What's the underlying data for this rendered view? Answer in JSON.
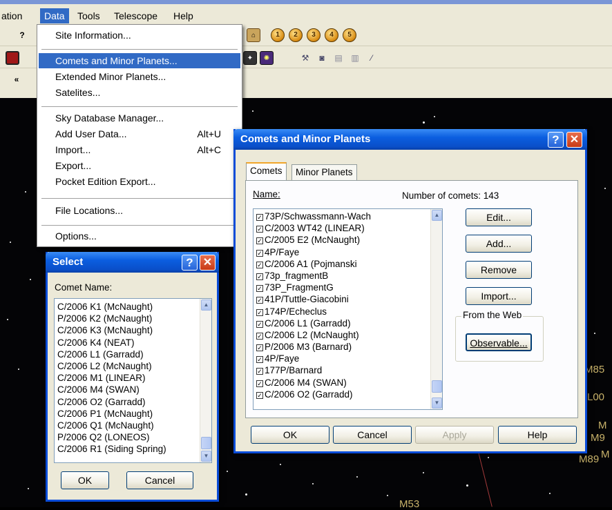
{
  "menubar": {
    "items": [
      "ation",
      "Data",
      "Tools",
      "Telescope",
      "Help"
    ]
  },
  "toolbar": {
    "icons": [
      "help-cursor-icon",
      "horizon-icon",
      "planet-1-icon",
      "planet-2-icon",
      "planet-3-icon",
      "planet-4-icon",
      "planet-5-icon",
      "rewind-icon"
    ]
  },
  "data_menu": {
    "site_information": "Site Information...",
    "comets": "Comets and Minor Planets...",
    "extended": "Extended Minor Planets...",
    "satellites": "Satelites...",
    "sky_db": "Sky Database Manager...",
    "add_user_data": "Add User Data...",
    "add_user_data_shortcut": "Alt+U",
    "import": "Import...",
    "import_shortcut": "Alt+C",
    "export": "Export...",
    "pocket": "Pocket Edition Export...",
    "file_locations": "File Locations...",
    "options": "Options..."
  },
  "comets_dialog": {
    "title": "Comets and Minor Planets",
    "help_glyph": "?",
    "close_glyph": "✕",
    "tabs": [
      "Comets",
      "Minor Planets"
    ],
    "name_label": "Name:",
    "count_label": "Number of comets: 143",
    "items": [
      "73P/Schwassmann-Wach",
      "C/2003 WT42 (LINEAR)",
      "C/2005 E2 (McNaught)",
      "4P/Faye",
      "C/2006 A1 (Pojmanski",
      "73p_fragmentB",
      "73P_FragmentG",
      "41P/Tuttle-Giacobini",
      "174P/Echeclus",
      "C/2006 L1 (Garradd)",
      "C/2006 L2 (McNaught)",
      "P/2006 M3 (Barnard)",
      "4P/Faye",
      "177P/Barnard",
      "C/2006 M4 (SWAN)",
      "C/2006 O2 (Garradd)"
    ],
    "buttons": {
      "edit": "Edit...",
      "add": "Add...",
      "remove": "Remove",
      "import": "Import...",
      "web_group": "From the Web",
      "observable": "Observable...",
      "ok": "OK",
      "cancel": "Cancel",
      "apply": "Apply",
      "help": "Help"
    }
  },
  "select_dialog": {
    "title": "Select",
    "label": "Comet Name:",
    "items": [
      "C/2006 K1 (McNaught)",
      "P/2006 K2 (McNaught)",
      "C/2006 K3 (McNaught)",
      "C/2006 K4 (NEAT)",
      "C/2006 L1 (Garradd)",
      "C/2006 L2 (McNaught)",
      "C/2006 M1 (LINEAR)",
      "C/2006 M4 (SWAN)",
      "C/2006 O2 (Garradd)",
      "C/2006 P1 (McNaught)",
      "C/2006 Q1 (McNaught)",
      "P/2006 Q2 (LONEOS)",
      "C/2006 R1 (Siding Spring)"
    ],
    "ok": "OK",
    "cancel": "Cancel"
  },
  "sky": {
    "labels": [
      "M85",
      "L00",
      "M",
      "M9",
      "M89",
      "M",
      "M53"
    ]
  }
}
